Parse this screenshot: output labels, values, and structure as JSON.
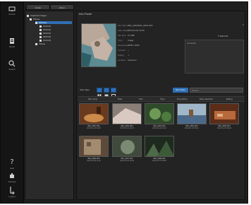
{
  "rail": {
    "items": [
      {
        "name": "screen",
        "label": "Screen",
        "icon": "monitor-icon"
      },
      {
        "name": "media",
        "label": "Media",
        "icon": "document-icon"
      },
      {
        "name": "search",
        "label": "Search",
        "icon": "search-icon"
      },
      {
        "name": "help",
        "label": "Help",
        "icon": "help-icon"
      },
      {
        "name": "settings",
        "label": "Settings",
        "icon": "settings-icon"
      },
      {
        "name": "logout",
        "label": "Logout",
        "icon": "logout-icon"
      }
    ]
  },
  "tree": {
    "tabs": [
      "Folder",
      "Album"
    ],
    "nodes": [
      {
        "label": "Captured Images",
        "depth": 0,
        "selected": false
      },
      {
        "label": "Photos",
        "depth": 1,
        "selected": false
      },
      {
        "label": "2013-01",
        "depth": 2,
        "selected": true
      },
      {
        "label": "2013-02",
        "depth": 3,
        "selected": false
      },
      {
        "label": "2013-03",
        "depth": 3,
        "selected": false
      },
      {
        "label": "2013-04",
        "depth": 3,
        "selected": false
      },
      {
        "label": "2013-05",
        "depth": 3,
        "selected": false
      },
      {
        "label": "2013-06",
        "depth": 3,
        "selected": false
      },
      {
        "label": "Videos",
        "depth": 1,
        "selected": false
      }
    ]
  },
  "main": {
    "title": "Info Panel",
    "edit_label": "Edit Info",
    "close": "×",
    "comment_label": "Comment",
    "meta": [
      {
        "k": "File Name",
        "v": "IMG_20130101_0001.JPG"
      },
      {
        "k": "Date Taken",
        "v": "2013-01-01 10:20"
      },
      {
        "k": "File Size",
        "v": "2.4 MB"
      },
      {
        "k": "Type",
        "v": "Image"
      },
      {
        "k": "Resolution",
        "v": "2048 x 1536"
      },
      {
        "k": "Camera",
        "v": "--"
      },
      {
        "k": "Rating",
        "v": "☆"
      },
      {
        "k": "Location",
        "v": "Unknown"
      }
    ],
    "toolbar": {
      "view_label": "View Type",
      "sort_label": "Sort Order",
      "search_placeholder": "Search"
    },
    "columns": [
      "File name",
      "Date",
      "Size",
      "Type",
      "Description",
      "Date captured",
      "Rating"
    ],
    "thumbnails": [
      {
        "cap": "IMG_0001.JPG",
        "sub": "2013-01-01 10:20",
        "c1": "#6a3a1e",
        "c2": "#c98a4a"
      },
      {
        "cap": "IMG_0002.JPG",
        "sub": "2013-01-01 10:21",
        "c1": "#8a7f78",
        "c2": "#d9c9c0"
      },
      {
        "cap": "IMG_0003.JPG",
        "sub": "2013-01-02 14:03",
        "c1": "#2f4a2a",
        "c2": "#6f9a56"
      },
      {
        "cap": "IMG_0004.JPG",
        "sub": "2013-01-03 09:11",
        "c1": "#4b6a8a",
        "c2": "#9fb7c9"
      },
      {
        "cap": "IMG_0005.JPG",
        "sub": "2013-01-04 18:42",
        "c1": "#5a2d18",
        "c2": "#b86a3c"
      },
      {
        "cap": "IMG_0006.JPG",
        "sub": "2013-01-05 11:30",
        "c1": "#5d4a3a",
        "c2": "#a38b6f"
      },
      {
        "cap": "IMG_0007.JPG",
        "sub": "2013-01-06 16:05",
        "c1": "#3f4a3c",
        "c2": "#7b8a72"
      },
      {
        "cap": "IMG_0008.JPG",
        "sub": "2013-01-07 08:50",
        "c1": "#1f2a1f",
        "c2": "#4f6a4a"
      }
    ]
  }
}
